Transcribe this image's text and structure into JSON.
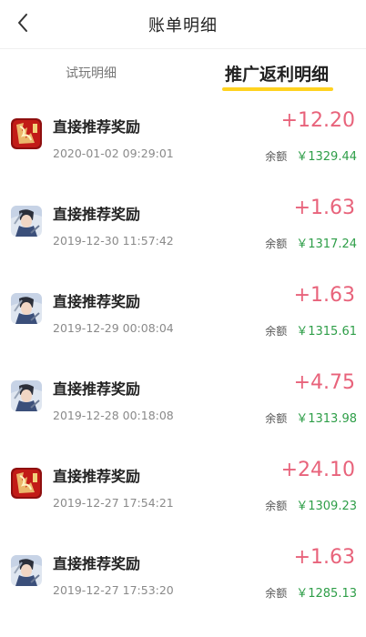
{
  "header": {
    "title": "账单明细",
    "back_icon": "chevron-left-icon"
  },
  "tabs": [
    {
      "label": "试玩明细",
      "active": false
    },
    {
      "label": "推广返利明细",
      "active": true
    }
  ],
  "colors": {
    "accent_underline": "#ffd21f",
    "amount": "#e8637b",
    "balance": "#2e9e48"
  },
  "transactions": [
    {
      "icon": "game-icon-red",
      "title": "直接推荐奖励",
      "time": "2020-01-02 09:29:01",
      "amount": "+12.20",
      "balance_label": "余额",
      "balance": "￥1329.44"
    },
    {
      "icon": "game-icon-warrior",
      "title": "直接推荐奖励",
      "time": "2019-12-30 11:57:42",
      "amount": "+1.63",
      "balance_label": "余额",
      "balance": "￥1317.24"
    },
    {
      "icon": "game-icon-warrior",
      "title": "直接推荐奖励",
      "time": "2019-12-29 00:08:04",
      "amount": "+1.63",
      "balance_label": "余额",
      "balance": "￥1315.61"
    },
    {
      "icon": "game-icon-warrior",
      "title": "直接推荐奖励",
      "time": "2019-12-28 00:18:08",
      "amount": "+4.75",
      "balance_label": "余额",
      "balance": "￥1313.98"
    },
    {
      "icon": "game-icon-red",
      "title": "直接推荐奖励",
      "time": "2019-12-27 17:54:21",
      "amount": "+24.10",
      "balance_label": "余额",
      "balance": "￥1309.23"
    },
    {
      "icon": "game-icon-warrior",
      "title": "直接推荐奖励",
      "time": "2019-12-27 17:53:20",
      "amount": "+1.63",
      "balance_label": "余额",
      "balance": "￥1285.13"
    }
  ]
}
